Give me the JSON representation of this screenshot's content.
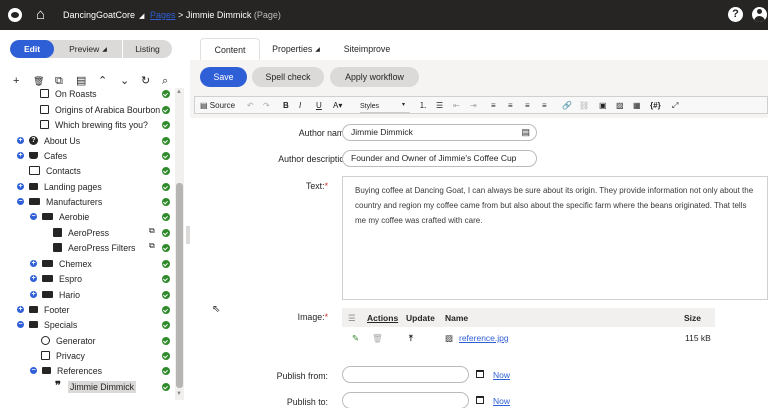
{
  "topbar": {
    "site_name": "DancingGoatCore",
    "crumb_pages": "Pages",
    "crumb_separator": ">",
    "crumb_current": "Jimmie Dimmick",
    "crumb_type": "(Page)",
    "help_label": "?"
  },
  "left_tabs": {
    "edit": "Edit",
    "preview": "Preview",
    "listing": "Listing"
  },
  "tree_tools": [
    "+",
    "🗑",
    "⧉",
    "▤",
    "⌃",
    "⌄",
    "↻",
    "⌕"
  ],
  "tree": [
    {
      "label": "On Roasts",
      "icon": "document-icon"
    },
    {
      "label": "Origins of Arabica Bourbon",
      "icon": "document-icon"
    },
    {
      "label": "Which brewing fits you?",
      "icon": "document-icon"
    },
    {
      "label": "About Us",
      "icon": "question-icon"
    },
    {
      "label": "Cafes",
      "icon": "cup-icon"
    },
    {
      "label": "Contacts",
      "icon": "contact-card-icon"
    },
    {
      "label": "Landing pages",
      "icon": "folder-icon"
    },
    {
      "label": "Manufacturers",
      "icon": "factory-icon"
    },
    {
      "label": "Aerobie",
      "icon": "factory-icon"
    },
    {
      "label": "AeroPress",
      "icon": "document-icon"
    },
    {
      "label": "AeroPress Filters",
      "icon": "document-icon"
    },
    {
      "label": "Chemex",
      "icon": "factory-icon"
    },
    {
      "label": "Espro",
      "icon": "factory-icon"
    },
    {
      "label": "Hario",
      "icon": "factory-icon"
    },
    {
      "label": "Footer",
      "icon": "folder-icon"
    },
    {
      "label": "Specials",
      "icon": "folder-icon"
    },
    {
      "label": "Generator",
      "icon": "generator-icon"
    },
    {
      "label": "Privacy",
      "icon": "privacy-icon"
    },
    {
      "label": "References",
      "icon": "folder-icon"
    },
    {
      "label": "Jimmie Dimmick",
      "icon": "quote-icon"
    }
  ],
  "content_tabs": {
    "content": "Content",
    "properties": "Properties",
    "siteimprove": "Siteimprove"
  },
  "actions": {
    "save": "Save",
    "spell_check": "Spell check",
    "apply_workflow": "Apply workflow"
  },
  "editor_toolbar": {
    "source": "Source",
    "styles": "Styles"
  },
  "form": {
    "author_name_label": "Author name:",
    "author_name_value": "Jimmie Dimmick",
    "author_desc_label": "Author description:",
    "author_desc_value": "Founder and Owner of Jimmie's Coffee Cup",
    "text_label": "Text:",
    "text_value": "Buying coffee at Dancing Goat, I can always be sure about its origin. They provide information not only about the country and region my coffee came from but also about the specific farm where the beans originated. That tells me my coffee was crafted with care.",
    "image_label": "Image:",
    "publish_from_label": "Publish from:",
    "publish_to_label": "Publish to:",
    "now_label": "Now",
    "required_mark": "*"
  },
  "image_table": {
    "headers": {
      "actions": "Actions",
      "update": "Update",
      "name": "Name",
      "size": "Size"
    },
    "row": {
      "name": "reference.jpg",
      "size": "115 kB"
    }
  },
  "colors": {
    "topbar": "#262524",
    "accent": "#2f5fd6",
    "published": "#2f8a2a"
  }
}
